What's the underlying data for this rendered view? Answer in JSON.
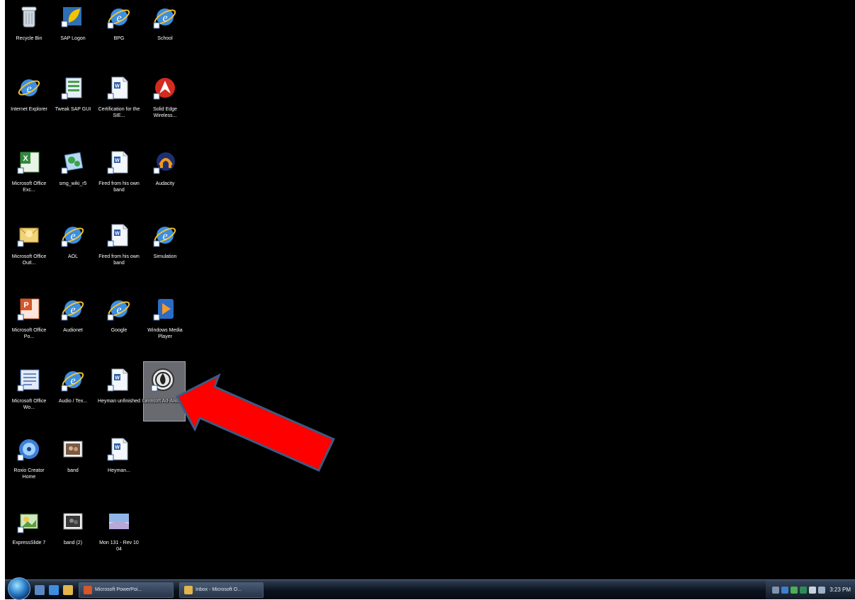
{
  "desktop": {
    "icons": [
      {
        "label": "Recycle Bin",
        "icon": "recycle-bin-icon"
      },
      {
        "label": "SAP Logon",
        "icon": "sap-logon-icon"
      },
      {
        "label": "BPG",
        "icon": "ie-shortcut-icon"
      },
      {
        "label": "School",
        "icon": "ie-shortcut-icon"
      },
      {
        "label": "Internet Explorer",
        "icon": "internet-explorer-icon"
      },
      {
        "label": "Tweak SAP GUI",
        "icon": "sap-gui-icon"
      },
      {
        "label": "Certification for the SIE...",
        "icon": "word-document-icon"
      },
      {
        "label": "Solid Edge Wireless...",
        "icon": "solid-edge-icon"
      },
      {
        "label": "Microsoft Office Exc...",
        "icon": "excel-icon"
      },
      {
        "label": "smg_wiki_r5",
        "icon": "program-icon"
      },
      {
        "label": "Fired from his own band",
        "icon": "word-document-icon"
      },
      {
        "label": "Audacity",
        "icon": "audacity-icon"
      },
      {
        "label": "Microsoft Office Outl...",
        "icon": "outlook-icon"
      },
      {
        "label": "AOL",
        "icon": "ie-shortcut-icon"
      },
      {
        "label": "Fired from his own band",
        "icon": "word-document-icon"
      },
      {
        "label": "Simulation",
        "icon": "ie-shortcut-icon"
      },
      {
        "label": "Microsoft Office Po...",
        "icon": "powerpoint-icon"
      },
      {
        "label": "Audionet",
        "icon": "ie-shortcut-icon"
      },
      {
        "label": "Google",
        "icon": "ie-shortcut-icon"
      },
      {
        "label": "Windows Media Player",
        "icon": "media-player-icon"
      },
      {
        "label": "Microsoft Office Wo...",
        "icon": "word-icon"
      },
      {
        "label": "Audio / Tex...",
        "icon": "ie-shortcut-icon"
      },
      {
        "label": "Heyman unfinished",
        "icon": "word-document-icon"
      },
      {
        "label": "Lavasoft Ad-Aware",
        "icon": "ad-aware-icon"
      },
      {
        "label": "Roxio Creator Home",
        "icon": "roxio-icon"
      },
      {
        "label": "band",
        "icon": "image-icon"
      },
      {
        "label": "Heyman...",
        "icon": "word-document-icon"
      },
      {
        "label": "ExpressSlide 7",
        "icon": "expressslide-icon"
      },
      {
        "label": "band (2)",
        "icon": "image-icon"
      },
      {
        "label": "Mon 131 - Rev 10 04",
        "icon": "landscape-image-icon"
      }
    ]
  },
  "taskbar": {
    "tasks": [
      {
        "label": "Microsoft PowerPoi..."
      },
      {
        "label": "Inbox - Microsoft O..."
      }
    ],
    "clock": "3:23 PM"
  },
  "colors": {
    "desktop": "#000000",
    "arrow_fill": "#ff0000",
    "arrow_stroke": "#3d5a80",
    "selection": "#8c8c96"
  }
}
